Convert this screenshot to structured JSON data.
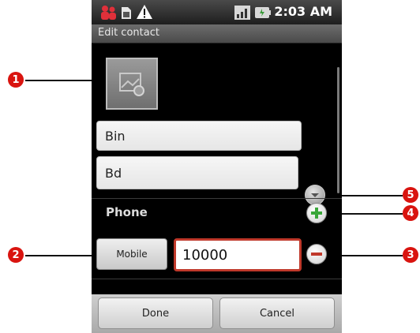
{
  "status_bar": {
    "time": "2:03 AM",
    "icons": [
      "contacts-notification-icon",
      "sd-card-icon",
      "warning-icon",
      "signal-icon",
      "battery-icon"
    ]
  },
  "title_bar": {
    "title": "Edit contact"
  },
  "contact": {
    "first_name": "Bin",
    "last_name": "Bd"
  },
  "phone_section": {
    "label": "Phone",
    "type": "Mobile",
    "number": "10000"
  },
  "buttons": {
    "done": "Done",
    "cancel": "Cancel"
  },
  "callouts": [
    "1",
    "2",
    "3",
    "4",
    "5"
  ],
  "colors": {
    "callout": "#d9140f",
    "add": "#3aa63a",
    "remove": "#c0392b",
    "focus_border": "#c0392b"
  }
}
